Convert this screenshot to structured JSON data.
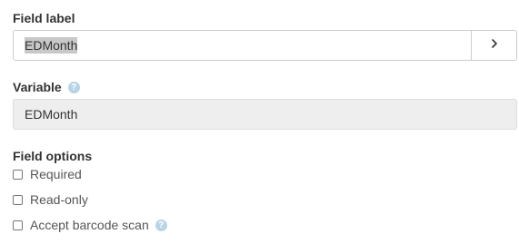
{
  "field_label": {
    "title": "Field label",
    "value": "EDMonth",
    "next_button_icon": "chevron-right-icon"
  },
  "variable": {
    "title": "Variable",
    "help_icon": "question-circle-icon",
    "value": "EDMonth"
  },
  "field_options": {
    "title": "Field options",
    "items": [
      {
        "label": "Required",
        "checked": false
      },
      {
        "label": "Read-only",
        "checked": false
      },
      {
        "label": "Accept barcode scan",
        "checked": false,
        "help_icon": "question-circle-icon"
      }
    ]
  },
  "colors": {
    "help_icon": "#b8d4e6",
    "readonly_bg": "#eeeeee",
    "text_selection": "#c8c8c8"
  }
}
